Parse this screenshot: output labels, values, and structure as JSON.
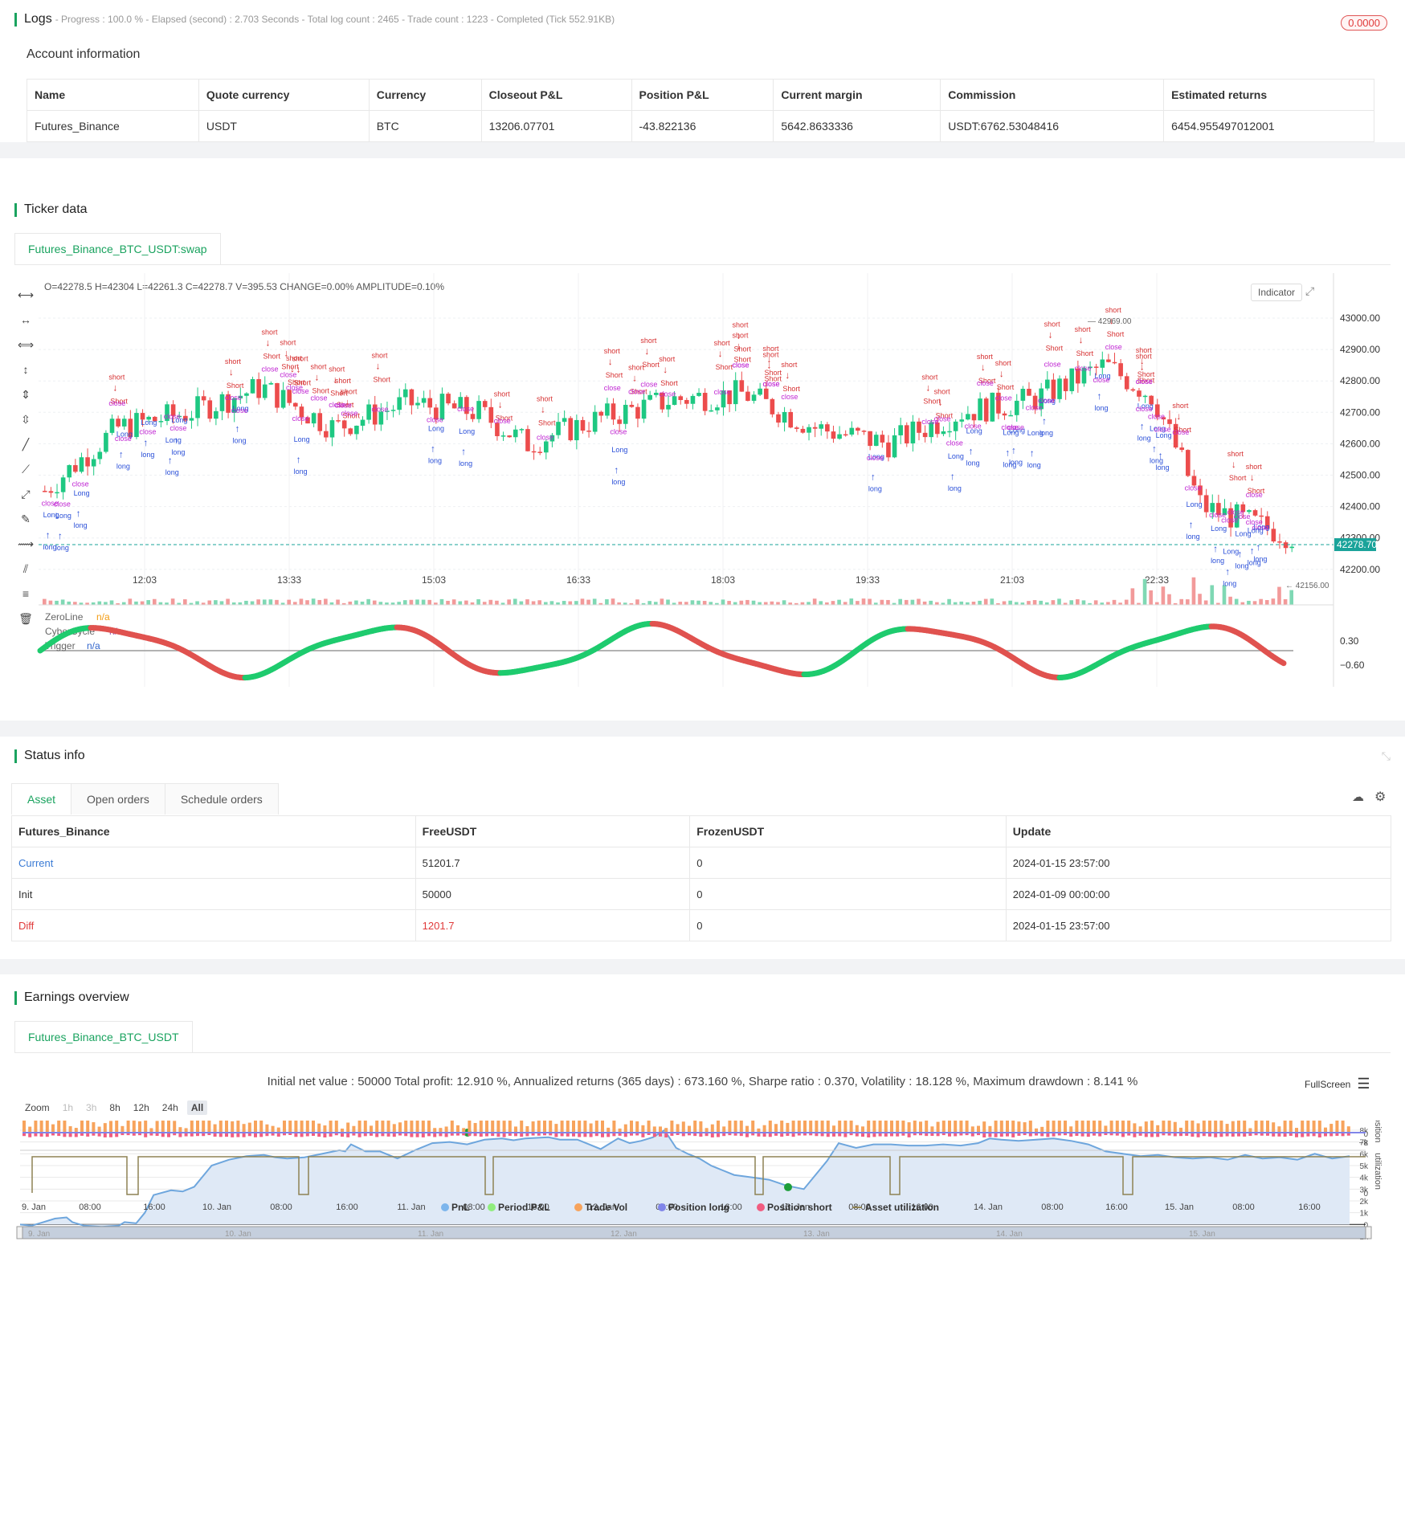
{
  "logs": {
    "title": "Logs",
    "meta": "- Progress : 100.0 % - Elapsed (second) : 2.703  Seconds - Total log count : 2465 - Trade count : 1223 - Completed (Tick 552.91KB)",
    "badge": "0.0000",
    "account_title": "Account information",
    "headers": [
      "Name",
      "Quote currency",
      "Currency",
      "Closeout P&L",
      "Position P&L",
      "Current margin",
      "Commission",
      "Estimated returns"
    ],
    "row": [
      "Futures_Binance",
      "USDT",
      "BTC",
      "13206.07701",
      "-43.822136",
      "5642.8633336",
      "USDT:6762.53048416",
      "6454.955497012001"
    ]
  },
  "ticker": {
    "title": "Ticker data",
    "tab": "Futures_Binance_BTC_USDT:swap",
    "ohlc": "O=42278.5 H=42304 L=42261.3 C=42278.7 V=395.53 CHANGE=0.00% AMPLITUDE=0.10%",
    "indicator_btn": "Indicator",
    "price_ticks": [
      "43000.00",
      "42900.00",
      "42800.00",
      "42700.00",
      "42600.00",
      "42500.00",
      "42400.00",
      "42300.00",
      "42200.00"
    ],
    "last_price": "42278.70",
    "high_label": "42969.00",
    "low_label": "42156.00",
    "time_ticks": [
      "12:03",
      "13:33",
      "15:03",
      "16:33",
      "18:03",
      "19:33",
      "21:03",
      "22:33"
    ],
    "osc_legend": [
      {
        "name": "ZeroLine",
        "val": "n/a",
        "color": "#f39c12"
      },
      {
        "name": "CyberCycle",
        "val": "n/a",
        "color": "#9b59b6"
      },
      {
        "name": "Trigger",
        "val": "n/a",
        "color": "#3366cc"
      }
    ],
    "osc_ticks": [
      "0.30",
      "−0.60"
    ],
    "marker_words": [
      "short",
      "Short",
      "long",
      "Long",
      "close"
    ]
  },
  "status": {
    "title": "Status info",
    "tabs": [
      "Asset",
      "Open orders",
      "Schedule orders"
    ],
    "headers": [
      "Futures_Binance",
      "FreeUSDT",
      "FrozenUSDT",
      "Update"
    ],
    "rows": [
      [
        "Current",
        "51201.7",
        "0",
        "2024-01-15 23:57:00"
      ],
      [
        "Init",
        "50000",
        "0",
        "2024-01-09 00:00:00"
      ],
      [
        "Diff",
        "1201.7",
        "0",
        "2024-01-15 23:57:00"
      ]
    ]
  },
  "earnings": {
    "title": "Earnings overview",
    "tab": "Futures_Binance_BTC_USDT",
    "summary": "Initial net value : 50000 Total profit: 12.910 %, Annualized returns (365 days) : 673.160 %, Sharpe ratio : 0.370, Volatility : 18.128 %, Maximum drawdown : 8.141 %",
    "fullscreen": "FullScreen",
    "zoom_label": "Zoom",
    "zoom": [
      "1h",
      "3h",
      "8h",
      "12h",
      "24h",
      "All"
    ],
    "pnl_ticks": [
      "8k",
      "7k",
      "6k",
      "5k",
      "4k",
      "3k",
      "2k",
      "1k",
      "0",
      "−1k"
    ],
    "period_ticks": [
      "0",
      "−2k"
    ],
    "vol_ticks": [
      "0",
      "−8"
    ],
    "util_ticks": [
      "0"
    ],
    "axis_titles": [
      "PnL",
      "Period P&L",
      "vol/position",
      "utilization"
    ],
    "x_ticks": [
      "9. Jan",
      "08:00",
      "16:00",
      "10. Jan",
      "08:00",
      "16:00",
      "11. Jan",
      "08:00",
      "16:00",
      "12. Jan",
      "08:00",
      "16:00",
      "13. Jan",
      "08:00",
      "16:00",
      "14. Jan",
      "08:00",
      "16:00",
      "15. Jan",
      "08:00",
      "16:00"
    ],
    "nav_ticks": [
      "9. Jan",
      "10. Jan",
      "11. Jan",
      "12. Jan",
      "13. Jan",
      "14. Jan",
      "15. Jan"
    ],
    "legend": [
      {
        "name": "PnL",
        "color": "#7cb5ec"
      },
      {
        "name": "Period P&L",
        "color": "#90ed7d"
      },
      {
        "name": "Trade Vol",
        "color": "#f7a35c"
      },
      {
        "name": "Position long",
        "color": "#8085e9"
      },
      {
        "name": "Position short",
        "color": "#f15c80"
      },
      {
        "name": "Asset utilization",
        "color": "#8d8254"
      }
    ]
  }
}
